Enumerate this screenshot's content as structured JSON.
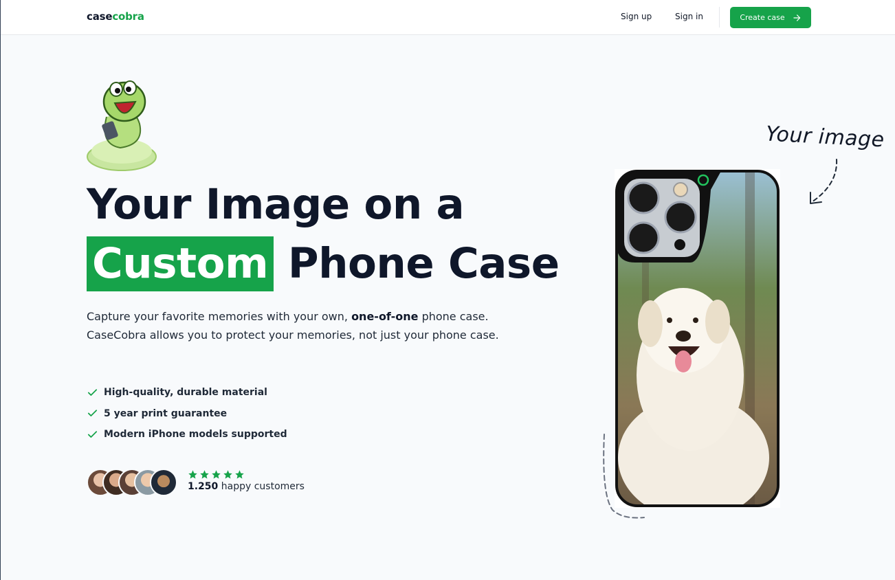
{
  "nav": {
    "logo_part1": "case",
    "logo_part2": "cobra",
    "signup": "Sign up",
    "signin": "Sign in",
    "create_case": "Create case"
  },
  "hero": {
    "headline_line1": "Your Image on a",
    "headline_highlight": "Custom",
    "headline_line2_rest": "Phone Case",
    "subtitle_part1": "Capture your favorite memories with your own, ",
    "subtitle_bold": "one-of-one",
    "subtitle_part2": " phone case. CaseCobra allows you to protect your memories, not just your phone case.",
    "features": [
      "High-quality, durable material",
      "5 year print guarantee",
      "Modern iPhone models supported"
    ],
    "rating_stars": 5,
    "customers_count": "1.250",
    "customers_label": "happy customers"
  },
  "annotation": {
    "your_image": "Your image"
  },
  "colors": {
    "accent": "#16a34a",
    "text": "#0f172a",
    "background": "#f8fafc"
  },
  "icons": [
    "arrow-right-icon",
    "check-icon",
    "star-icon"
  ]
}
